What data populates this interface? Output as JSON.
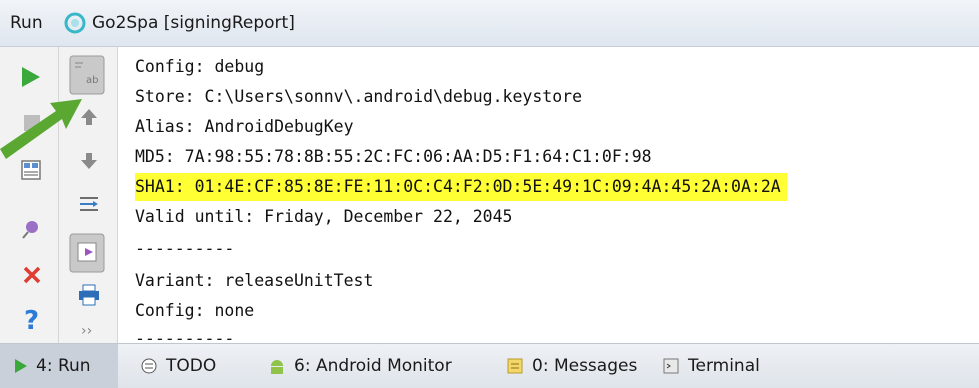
{
  "title_bar": {
    "run_label": "Run",
    "process_label": "Go2Spa [signingReport]"
  },
  "console": {
    "lines": [
      "Config: debug",
      "Store: C:\\Users\\sonnv\\.android\\debug.keystore",
      "Alias: AndroidDebugKey",
      "MD5: 7A:98:55:78:8B:55:2C:FC:06:AA:D5:F1:64:C1:0F:98",
      "SHA1: 01:4E:CF:85:8E:FE:11:0C:C4:F2:0D:5E:49:1C:09:4A:45:2A:0A:2A",
      "Valid until: Friday, December 22, 2045",
      "----------",
      "Variant: releaseUnitTest",
      "Config: none",
      "----------"
    ],
    "highlight_color": "#ffff33"
  },
  "toolbar_left": [
    "run-icon",
    "stop-icon",
    "layout-icon",
    "pin-icon",
    "close-icon",
    "help-icon"
  ],
  "toolbar_right": [
    "soft-wrap-icon",
    "up-icon",
    "down-icon",
    "scroll-to-end-icon",
    "use-soft-wraps-icon",
    "print-icon",
    "more-icon"
  ],
  "more_glyph": "››",
  "bottom_tabs": {
    "run": "4: Run",
    "todo": "TODO",
    "android_monitor": "6: Android Monitor",
    "messages": "0: Messages",
    "terminal": "Terminal"
  },
  "annotation_arrow_color": "#5aa832"
}
